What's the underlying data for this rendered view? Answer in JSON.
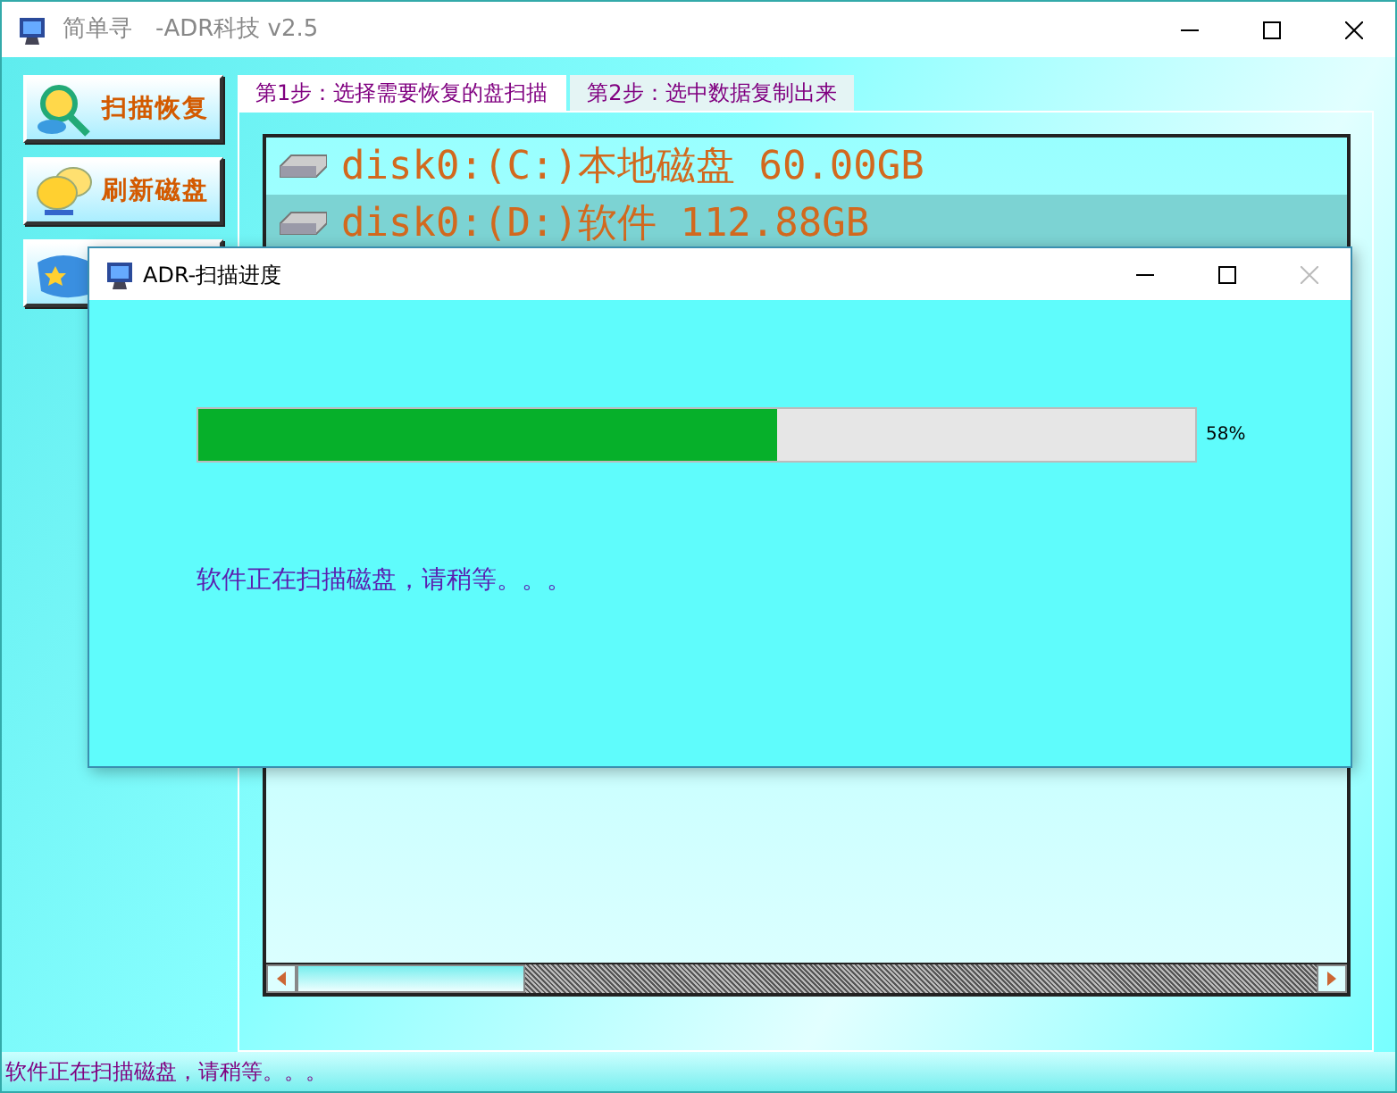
{
  "window": {
    "title": "简单寻　-ADR科技 v2.5"
  },
  "sidebar": {
    "buttons": [
      {
        "kind": "search",
        "label": "扫描恢复"
      },
      {
        "kind": "refresh",
        "label": "刷新磁盘"
      },
      {
        "kind": "star"
      }
    ]
  },
  "tabs": [
    {
      "label": "第1步：选择需要恢复的盘扫描",
      "selected": true
    },
    {
      "label": "第2步：选中数据复制出来",
      "selected": false
    }
  ],
  "disks": [
    {
      "label": "disk0:(C:)本地磁盘 60.00GB",
      "selected": false
    },
    {
      "label": "disk0:(D:)软件 112.88GB",
      "selected": true
    }
  ],
  "dialog": {
    "title": "ADR-扫描进度",
    "close_disabled": true,
    "level": 0.58,
    "percent": "58%",
    "message": "软件正在扫描磁盘，请稍等。。。"
  },
  "status_bar": {
    "text": "软件正在扫描磁盘，请稍等。。。"
  }
}
